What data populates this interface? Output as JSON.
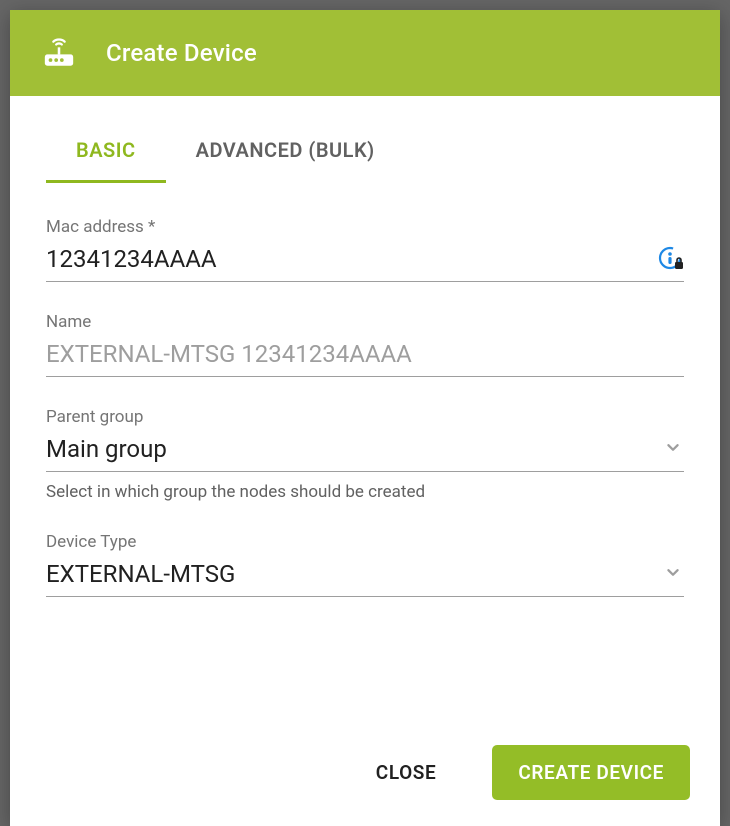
{
  "header": {
    "title": "Create Device"
  },
  "tabs": {
    "basic": "BASIC",
    "advanced": "ADVANCED (BULK)"
  },
  "fields": {
    "mac": {
      "label": "Mac address *",
      "value": "12341234AAAA"
    },
    "name": {
      "label": "Name",
      "placeholder": "EXTERNAL-MTSG 12341234AAAA"
    },
    "parent": {
      "label": "Parent group",
      "value": "Main group",
      "helper": "Select in which group the nodes should be created"
    },
    "type": {
      "label": "Device Type",
      "value": "EXTERNAL-MTSG"
    }
  },
  "actions": {
    "close": "CLOSE",
    "create": "CREATE DEVICE"
  }
}
